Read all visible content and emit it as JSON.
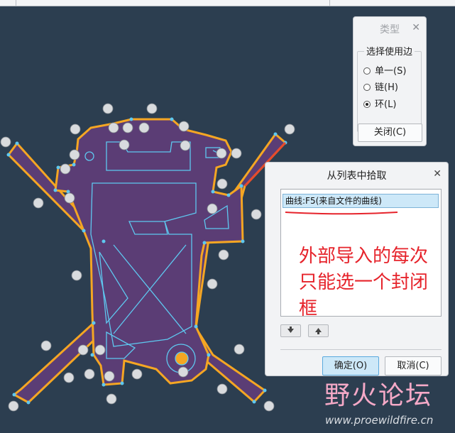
{
  "top_strip": {
    "left_text": "",
    "right_text": ""
  },
  "type_dialog": {
    "title": "类型",
    "close_icon": "close-icon",
    "group_label": "选择使用边",
    "options": [
      {
        "label": "单一(S)",
        "selected": false
      },
      {
        "label": "链(H)",
        "selected": false
      },
      {
        "label": "环(L)",
        "selected": true
      }
    ],
    "close_button": "关闭(C)"
  },
  "pick_dialog": {
    "title": "从列表中拾取",
    "close_icon": "close-icon",
    "list_items": [
      "曲线:F5(来自文件的曲线)"
    ],
    "annotation": "外部导入的每次只能选一个封闭框",
    "down_icon": "arrow-down-icon",
    "up_icon": "arrow-up-icon",
    "ok_button": "确定(O)",
    "cancel_button": "取消(C)"
  },
  "watermark": {
    "title": "野火论坛",
    "url": "www.proewildfire.cn"
  },
  "colors": {
    "background": "#2c3e50",
    "shape_fill": "#5b3d75",
    "outline": "#f5a623",
    "inner_lines": "#5ec8f0",
    "annotation": "#e6232b"
  }
}
